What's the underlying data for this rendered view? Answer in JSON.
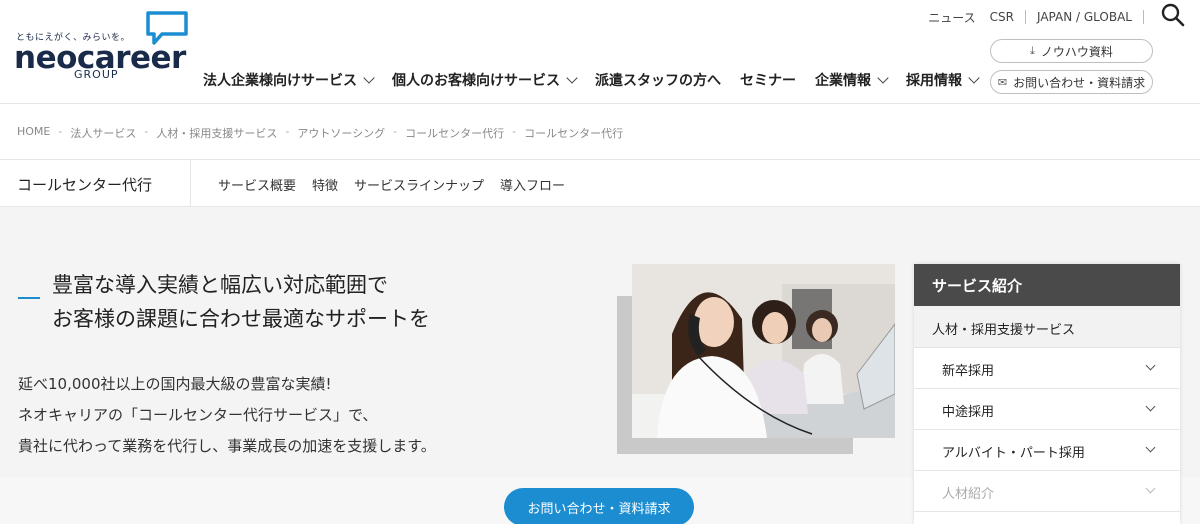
{
  "logo": {
    "tagline": "ともにえがく、みらいを。",
    "neo": "neo",
    "career": "career",
    "group": "GROUP"
  },
  "util_nav": {
    "items": [
      "ニュース",
      "CSR",
      "JAPAN / GLOBAL"
    ]
  },
  "header_buttons": {
    "knowhow": "ノウハウ資料",
    "contact": "お問い合わせ・資料請求"
  },
  "global_nav": {
    "items": [
      {
        "label": "法人企業様向けサービス",
        "dropdown": true
      },
      {
        "label": "個人のお客様向けサービス",
        "dropdown": true
      },
      {
        "label": "派遣スタッフの方へ",
        "dropdown": false
      },
      {
        "label": "セミナー",
        "dropdown": false
      },
      {
        "label": "企業情報",
        "dropdown": true
      },
      {
        "label": "採用情報",
        "dropdown": true
      }
    ]
  },
  "breadcrumb": [
    "HOME",
    "法人サービス",
    "人材・採用支援サービス",
    "アウトソーシング",
    "コールセンター代行",
    "コールセンター代行"
  ],
  "breadcrumb_sep": "-",
  "subnav": {
    "title": "コールセンター代行",
    "links": [
      "サービス概要",
      "特徴",
      "サービスラインナップ",
      "導入フロー"
    ]
  },
  "hero": {
    "headline_line1": "豊富な導入実績と幅広い対応範囲で",
    "headline_line2": "お客様の課題に合わせ最適なサポートを",
    "body_line1": "延べ10,000社以上の国内最大級の豊富な実績!",
    "body_line2": "ネオキャリアの「コールセンター代行サービス」で、",
    "body_line3": "貴社に代わって業務を代行し、事業成長の加速を支援します。"
  },
  "sidebar": {
    "heading": "サービス紹介",
    "category": "人材・採用支援サービス",
    "items": [
      {
        "label": "新卒採用"
      },
      {
        "label": "中途採用"
      },
      {
        "label": "アルバイト・パート採用"
      },
      {
        "label": "人材紹介"
      }
    ]
  },
  "cta": {
    "label": "お問い合わせ・資料請求"
  },
  "colors": {
    "accent": "#1b8dd0",
    "brand_navy": "#1a2b4a",
    "sidebar_header": "#4a4a4a"
  }
}
